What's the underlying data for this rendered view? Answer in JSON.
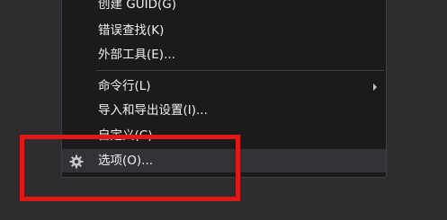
{
  "menu": {
    "items": [
      {
        "label": "创建 GUID(G)"
      },
      {
        "label": "错误查找(K)"
      },
      {
        "label": "外部工具(E)..."
      },
      {
        "label": "命令行(L)"
      },
      {
        "label": "导入和导出设置(I)..."
      },
      {
        "label": "自定义(C)..."
      },
      {
        "label": "选项(O)..."
      }
    ]
  },
  "icons": {
    "options": "gear-icon",
    "submenu": "chevron-right-icon"
  },
  "annotation": {
    "highlight_color": "#e01818"
  }
}
